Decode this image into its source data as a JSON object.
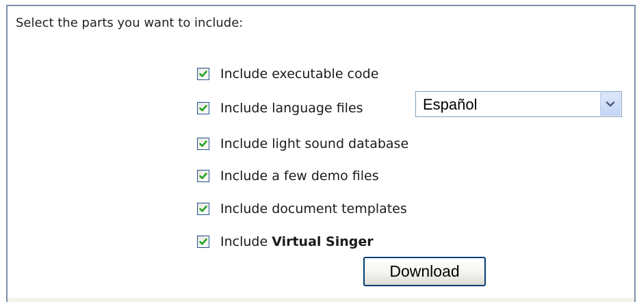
{
  "heading": "Select the parts you want to include:",
  "options": [
    {
      "label": "Include executable code",
      "checked": true
    },
    {
      "label": "Include language files",
      "checked": true
    },
    {
      "label": "Include light sound database",
      "checked": true
    },
    {
      "label": "Include a few demo files",
      "checked": true
    },
    {
      "label": "Include document templates",
      "checked": true
    },
    {
      "label_prefix": "Include ",
      "label_bold": "Virtual Singer",
      "checked": true
    }
  ],
  "language_select": {
    "selected": "Español"
  },
  "download_button": {
    "label": "Download"
  },
  "colors": {
    "panel_border": "#7a8fa6",
    "checkbox_border": "#1f4f8f",
    "check_mark": "#21a121",
    "button_border": "#003c74",
    "bottom_band": "#f3f3ea"
  },
  "icons": {
    "checkbox_mark": "check-icon",
    "select_arrow": "chevron-down-icon"
  }
}
